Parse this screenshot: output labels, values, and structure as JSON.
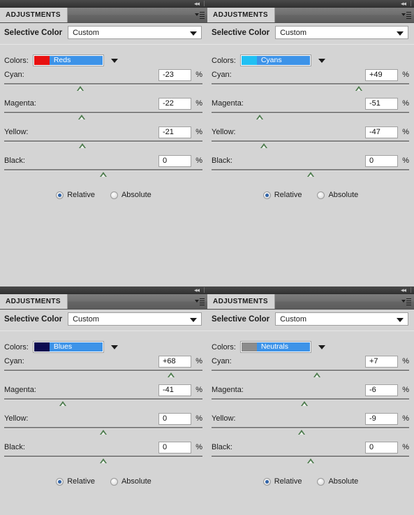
{
  "app": {
    "panel_tab_label": "ADJUSTMENTS",
    "panel_title": "Selective Color",
    "preset_value": "Custom",
    "colors_label": "Colors:",
    "percent_symbol": "%",
    "collapse_icon": "◂◂",
    "radio_relative": "Relative",
    "radio_absolute": "Absolute",
    "accent_highlight": "#3d93e8",
    "panel_bg": "#d4d4d4"
  },
  "panels": [
    {
      "id": "panel-reds",
      "color_name": "Reds",
      "swatch_color": "#e81010",
      "mode": "Relative",
      "channels": [
        {
          "label": "Cyan:",
          "value": "-23",
          "pct": -23
        },
        {
          "label": "Magenta:",
          "value": "-22",
          "pct": -22
        },
        {
          "label": "Yellow:",
          "value": "-21",
          "pct": -21
        },
        {
          "label": "Black:",
          "value": "0",
          "pct": 0
        }
      ]
    },
    {
      "id": "panel-cyans",
      "color_name": "Cyans",
      "swatch_color": "#21c0f3",
      "mode": "Relative",
      "channels": [
        {
          "label": "Cyan:",
          "value": "+49",
          "pct": 49
        },
        {
          "label": "Magenta:",
          "value": "-51",
          "pct": -51
        },
        {
          "label": "Yellow:",
          "value": "-47",
          "pct": -47
        },
        {
          "label": "Black:",
          "value": "0",
          "pct": 0
        }
      ]
    },
    {
      "id": "panel-blues",
      "color_name": "Blues",
      "swatch_color": "#0c0a50",
      "mode": "Relative",
      "channels": [
        {
          "label": "Cyan:",
          "value": "+68",
          "pct": 68
        },
        {
          "label": "Magenta:",
          "value": "-41",
          "pct": -41
        },
        {
          "label": "Yellow:",
          "value": "0",
          "pct": 0
        },
        {
          "label": "Black:",
          "value": "0",
          "pct": 0
        }
      ]
    },
    {
      "id": "panel-neutrals",
      "color_name": "Neutrals",
      "swatch_color": "#8c8c8c",
      "mode": "Relative",
      "channels": [
        {
          "label": "Cyan:",
          "value": "+7",
          "pct": 7
        },
        {
          "label": "Magenta:",
          "value": "-6",
          "pct": -6
        },
        {
          "label": "Yellow:",
          "value": "-9",
          "pct": -9
        },
        {
          "label": "Black:",
          "value": "0",
          "pct": 0
        }
      ]
    }
  ]
}
